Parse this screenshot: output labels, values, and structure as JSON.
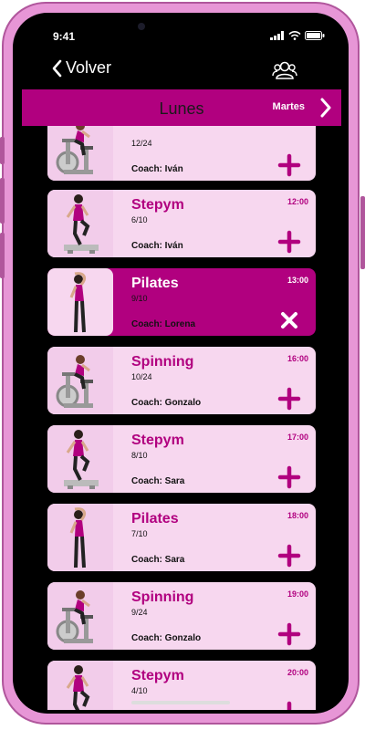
{
  "status": {
    "time": "9:41"
  },
  "nav": {
    "back_label": "Volver"
  },
  "day": {
    "title": "Lunes",
    "next_label": "Martes"
  },
  "classes": [
    {
      "name": "",
      "time": "",
      "capacity": "12/24",
      "coach": "Coach: Iván",
      "action": "add",
      "figure": "spinning"
    },
    {
      "name": "Stepym",
      "time": "12:00",
      "capacity": "6/10",
      "coach": "Coach: Iván",
      "action": "add",
      "figure": "step"
    },
    {
      "name": "Pilates",
      "time": "13:00",
      "capacity": "9/10",
      "coach": "Coach: Lorena",
      "action": "remove",
      "figure": "pilates"
    },
    {
      "name": "Spinning",
      "time": "16:00",
      "capacity": "10/24",
      "coach": "Coach: Gonzalo",
      "action": "add",
      "figure": "spinning"
    },
    {
      "name": "Stepym",
      "time": "17:00",
      "capacity": "8/10",
      "coach": "Coach: Sara",
      "action": "add",
      "figure": "step"
    },
    {
      "name": "Pilates",
      "time": "18:00",
      "capacity": "7/10",
      "coach": "Coach: Sara",
      "action": "add",
      "figure": "pilates"
    },
    {
      "name": "Spinning",
      "time": "19:00",
      "capacity": "9/24",
      "coach": "Coach: Gonzalo",
      "action": "add",
      "figure": "spinning"
    },
    {
      "name": "Stepym",
      "time": "20:00",
      "capacity": "4/10",
      "coach": "",
      "action": "add",
      "figure": "step"
    }
  ],
  "colors": {
    "accent": "#b1007f",
    "card": "#f7d7ef",
    "frame": "#e796d6"
  }
}
